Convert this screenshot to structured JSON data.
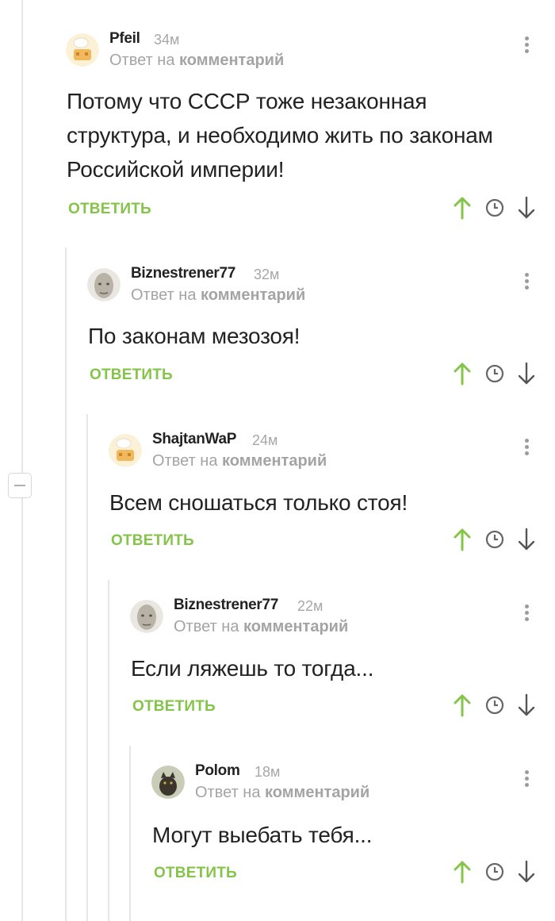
{
  "colors": {
    "accent_green": "#84c449",
    "muted_text": "#a4a4a4",
    "tree_line": "#e6e6e6"
  },
  "collapse": {
    "icon": "minus-icon"
  },
  "comments": [
    {
      "author": "Pfeil",
      "time": "34м",
      "reply_prefix": "Ответ на",
      "reply_target": "комментарий",
      "text_lines": [
        "Потому что СССР тоже незаконная",
        "структура, и необходимо жить по законам",
        "Российской империи!"
      ],
      "reply_label": "ОТВЕТИТЬ",
      "avatar": "chef-cartoon-avatar"
    },
    {
      "author": "Biznestrener77",
      "time": "32м",
      "reply_prefix": "Ответ на",
      "reply_target": "комментарий",
      "text_lines": [
        "По законам мезозоя!"
      ],
      "reply_label": "ОТВЕТИТЬ",
      "avatar": "bald-head-avatar"
    },
    {
      "author": "ShajtanWaP",
      "time": "24м",
      "reply_prefix": "Ответ на",
      "reply_target": "комментарий",
      "text_lines": [
        "Всем сношаться только стоя!"
      ],
      "reply_label": "ОТВЕТИТЬ",
      "avatar": "chef-cartoon-avatar"
    },
    {
      "author": "Biznestrener77",
      "time": "22м",
      "reply_prefix": "Ответ на",
      "reply_target": "комментарий",
      "text_lines": [
        "Если ляжешь то тогда..."
      ],
      "reply_label": "ОТВЕТИТЬ",
      "avatar": "bald-head-avatar"
    },
    {
      "author": "Polom",
      "time": "18м",
      "reply_prefix": "Ответ на",
      "reply_target": "комментарий",
      "text_lines": [
        "Могут выебать тебя..."
      ],
      "reply_label": "ОТВЕТИТЬ",
      "avatar": "cat-photo-avatar"
    }
  ]
}
